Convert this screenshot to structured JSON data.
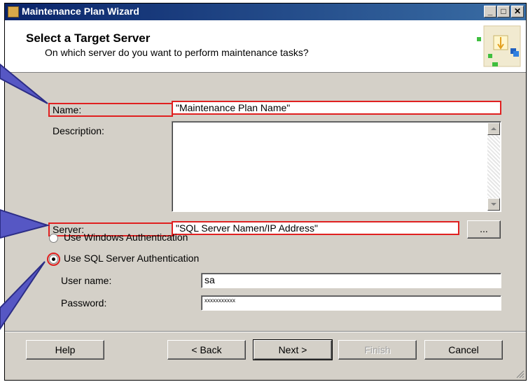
{
  "window": {
    "title": "Maintenance Plan Wizard"
  },
  "titlebar_buttons": {
    "minimize": "_",
    "maximize": "□",
    "close": "✕"
  },
  "header": {
    "title": "Select a Target Server",
    "subtitle": "On which server do you want to perform maintenance tasks?"
  },
  "form": {
    "name_label": "Name:",
    "name_value": "\"Maintenance Plan Name\"",
    "description_label": "Description:",
    "description_value": "",
    "server_label": "Server:",
    "server_value": "\"SQL Server Namen/IP Address\"",
    "browse_label": "...",
    "auth_windows_label": "Use Windows Authentication",
    "auth_sql_label": "Use SQL Server Authentication",
    "selected_auth": "sql",
    "username_label": "User name:",
    "username_value": "sa",
    "password_label": "Password:",
    "password_value": "xxxxxxxxxxx"
  },
  "buttons": {
    "help": "Help",
    "back": "< Back",
    "next": "Next >",
    "finish": "Finish",
    "cancel": "Cancel"
  },
  "colors": {
    "highlight": "#e02020",
    "callout_arrow": "#3d3f9a",
    "title_gradient_start": "#0a246a",
    "title_gradient_end": "#3a6ea5",
    "dialog_face": "#d4d0c8"
  }
}
